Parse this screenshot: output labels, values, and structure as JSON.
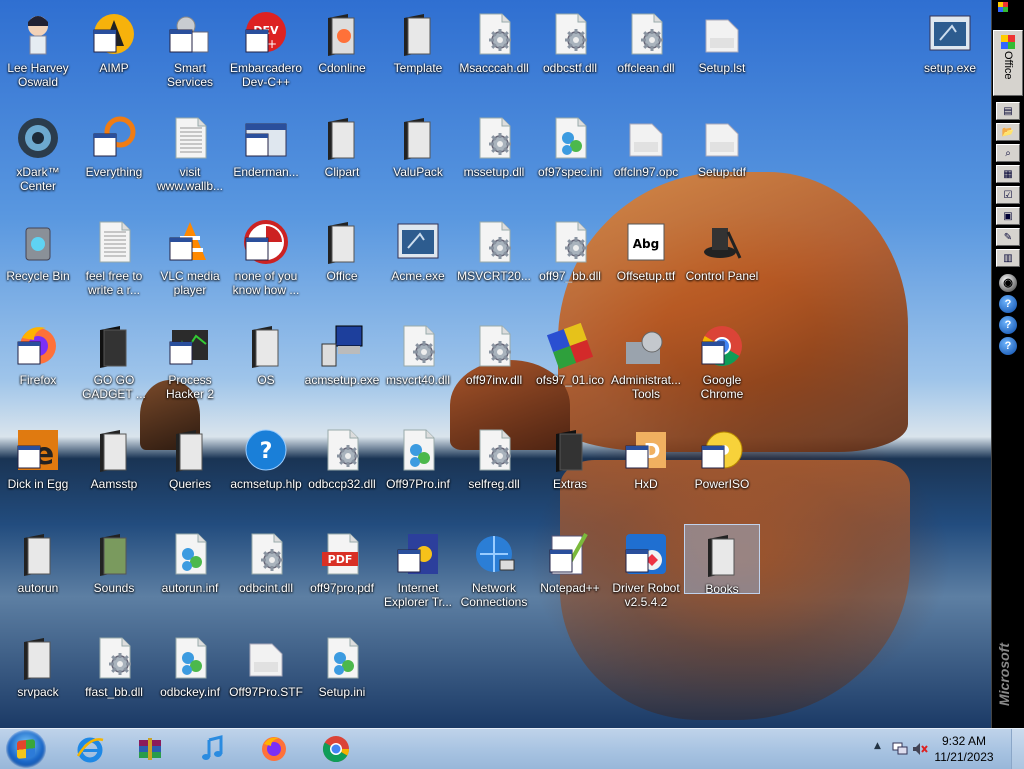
{
  "desktop": {
    "icons": [
      {
        "label": "Lee Harvey Oswald",
        "icon": "anime-avatar-icon"
      },
      {
        "label": "AIMP",
        "icon": "aimp-icon"
      },
      {
        "label": "Smart Services",
        "icon": "gear-services-icon"
      },
      {
        "label": "Embarcadero Dev-C++",
        "icon": "devcpp-icon"
      },
      {
        "label": "Cdonline",
        "icon": "folder-firefox-icon"
      },
      {
        "label": "Template",
        "icon": "folder-icon"
      },
      {
        "label": "Msacccah.dll",
        "icon": "dll-gear-icon"
      },
      {
        "label": "odbcstf.dll",
        "icon": "dll-gear-icon"
      },
      {
        "label": "offclean.dll",
        "icon": "dll-gear-icon"
      },
      {
        "label": "Setup.lst",
        "icon": "file-icon"
      },
      {
        "label": "setup.exe",
        "icon": "setup-exe-icon"
      },
      {
        "label": "xDark™ Center",
        "icon": "xdark-icon"
      },
      {
        "label": "Everything",
        "icon": "everything-icon"
      },
      {
        "label": "visit www.wallb...",
        "icon": "text-doc-icon"
      },
      {
        "label": "Enderman...",
        "icon": "program-window-icon"
      },
      {
        "label": "Clipart",
        "icon": "folder-icon"
      },
      {
        "label": "ValuPack",
        "icon": "folder-icon"
      },
      {
        "label": "mssetup.dll",
        "icon": "dll-gear-icon"
      },
      {
        "label": "of97spec.ini",
        "icon": "ini-gears-icon"
      },
      {
        "label": "offcln97.opc",
        "icon": "file-icon"
      },
      {
        "label": "Setup.tdf",
        "icon": "file-icon"
      },
      {
        "label": "Recycle Bin",
        "icon": "recycle-bin-icon"
      },
      {
        "label": "feel free to write a r...",
        "icon": "text-doc-icon"
      },
      {
        "label": "VLC media player",
        "icon": "vlc-icon"
      },
      {
        "label": "none of you know how ...",
        "icon": "circle-app-icon"
      },
      {
        "label": "Office",
        "icon": "folder-icon"
      },
      {
        "label": "Acme.exe",
        "icon": "setup-exe-icon"
      },
      {
        "label": "MSVCRT20...",
        "icon": "dll-gear-icon"
      },
      {
        "label": "off97_bb.dll",
        "icon": "dll-gear-icon"
      },
      {
        "label": "Offsetup.ttf",
        "icon": "font-file-icon"
      },
      {
        "label": "Control Panel",
        "icon": "control-panel-icon"
      },
      {
        "label": "Firefox",
        "icon": "firefox-icon"
      },
      {
        "label": "GO GO GADGET ...",
        "icon": "folder-dark-icon"
      },
      {
        "label": "Process Hacker 2",
        "icon": "process-hacker-icon"
      },
      {
        "label": "OS",
        "icon": "folder-icon"
      },
      {
        "label": "acmsetup.exe",
        "icon": "computer-setup-icon"
      },
      {
        "label": "msvcrt40.dll",
        "icon": "dll-gear-icon"
      },
      {
        "label": "off97inv.dll",
        "icon": "dll-gear-icon"
      },
      {
        "label": "ofs97_01.ico",
        "icon": "office-puzzle-icon"
      },
      {
        "label": "Administrat... Tools",
        "icon": "admin-tools-icon"
      },
      {
        "label": "Google Chrome",
        "icon": "chrome-icon"
      },
      {
        "label": "Dick in Egg",
        "icon": "egg-app-icon"
      },
      {
        "label": "Aamsstp",
        "icon": "folder-icon"
      },
      {
        "label": "Queries",
        "icon": "folder-icon"
      },
      {
        "label": "acmsetup.hlp",
        "icon": "help-icon"
      },
      {
        "label": "odbccp32.dll",
        "icon": "dll-gear-icon"
      },
      {
        "label": "Off97Pro.inf",
        "icon": "ini-gears-icon"
      },
      {
        "label": "selfreg.dll",
        "icon": "dll-gear-icon"
      },
      {
        "label": "Extras",
        "icon": "folder-dark-icon"
      },
      {
        "label": "HxD",
        "icon": "hxd-icon"
      },
      {
        "label": "PowerISO",
        "icon": "poweriso-icon"
      },
      {
        "label": "autorun",
        "icon": "folder-icon"
      },
      {
        "label": "Sounds",
        "icon": "folder-green-icon"
      },
      {
        "label": "autorun.inf",
        "icon": "ini-gears-icon"
      },
      {
        "label": "odbcint.dll",
        "icon": "dll-gear-icon"
      },
      {
        "label": "off97pro.pdf",
        "icon": "pdf-icon"
      },
      {
        "label": "Internet Explorer Tr...",
        "icon": "ie-trouble-icon"
      },
      {
        "label": "Network Connections",
        "icon": "network-icon"
      },
      {
        "label": "Notepad++",
        "icon": "notepadpp-icon"
      },
      {
        "label": "Driver Robot v2.5.4.2",
        "icon": "driver-robot-icon"
      },
      {
        "label": "Books",
        "icon": "folder-icon",
        "selected": true
      },
      {
        "label": "srvpack",
        "icon": "folder-icon"
      },
      {
        "label": "ffast_bb.dll",
        "icon": "dll-gear-icon"
      },
      {
        "label": "odbckey.inf",
        "icon": "ini-gears-icon"
      },
      {
        "label": "Off97Pro.STF",
        "icon": "file-icon"
      },
      {
        "label": "Setup.ini",
        "icon": "ini-gears-icon"
      }
    ]
  },
  "office_bar": {
    "title": "Office",
    "brand": "Microsoft",
    "buttons": [
      "new-doc-icon",
      "open-doc-icon",
      "find-icon",
      "calendar-icon",
      "task-icon",
      "contact-icon",
      "note-icon",
      "journal-icon"
    ],
    "help_buttons": [
      "?",
      "?",
      "?"
    ]
  },
  "taskbar": {
    "pinned": [
      "internet-explorer-icon",
      "winrar-icon",
      "itunes-icon",
      "firefox-icon",
      "chrome-icon"
    ],
    "clock": {
      "time": "9:32 AM",
      "date": "11/21/2023"
    }
  },
  "colors": {
    "taskbar": "#a9c4e2",
    "office_bar": "#000000",
    "label_text": "#ffffff"
  }
}
